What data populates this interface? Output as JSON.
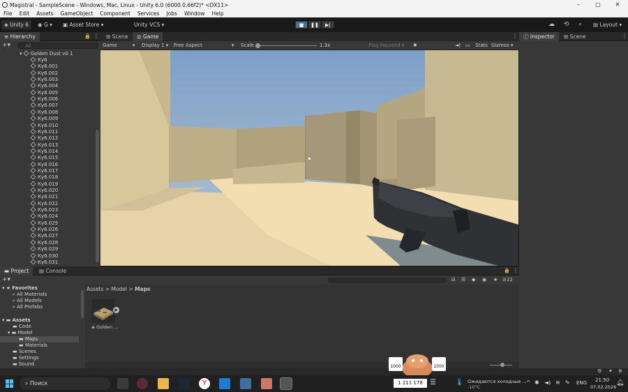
{
  "window": {
    "title": "Magistral - SampleScene - Windows, Mac, Linux - Unity 6.0 (6000.0.66f2)* <DX11>",
    "minimize": "–",
    "maximize": "□",
    "close": "✕"
  },
  "menu": [
    "File",
    "Edit",
    "Assets",
    "GameObject",
    "Component",
    "Services",
    "Jobs",
    "Window",
    "Help"
  ],
  "toolbar": {
    "account": "Unity 6",
    "user": "G",
    "asset_store": "Asset Store",
    "vcs": "Unity VCS",
    "layout": "Layout"
  },
  "hierarchy": {
    "tab": "Hierarchy",
    "search_placeholder": "All",
    "root": "Golden Dust v0.1",
    "items": [
      "Ку6",
      "Ку6.001",
      "Ку6.002",
      "Ку6.003",
      "Ку6.004",
      "Ку6.005",
      "Ку6.006",
      "Ку6.007",
      "Ку6.008",
      "Ку6.009",
      "Ку6.010",
      "Ку6.011",
      "Ку6.012",
      "Ку6.013",
      "Ку6.014",
      "Ку6.015",
      "Ку6.016",
      "Ку6.017",
      "Ку6.018",
      "Ку6.019",
      "Ку6.020",
      "Ку6.021",
      "Ку6.022",
      "Ку6.023",
      "Ку6.024",
      "Ку6.025",
      "Ку6.026",
      "Ку6.027",
      "Ку6.028",
      "Ку6.029",
      "Ку6.030",
      "Ку6.031"
    ]
  },
  "game": {
    "tab_scene": "Scene",
    "tab_game": "Game",
    "mode": "Game",
    "display": "Display 1",
    "aspect": "Free Aspect",
    "scale_label": "Scale",
    "scale_value": "1.3x",
    "play_focused": "Play Focused",
    "stats": "Stats",
    "gizmos": "Gizmos"
  },
  "inspector": {
    "tab": "Inspector",
    "tab2": "Scene"
  },
  "project": {
    "tab": "Project",
    "tab2": "Console",
    "count": "22",
    "breadcrumb": [
      "Assets",
      "Model",
      "Maps"
    ],
    "favorites": "Favorites",
    "fav_items": [
      "All Materials",
      "All Models",
      "All Prefabs"
    ],
    "assets": "Assets",
    "tree": [
      "Code",
      "Model",
      "Maps",
      "Materials",
      "Scenes",
      "Settings",
      "Sound"
    ],
    "asset_name": "Golden ..."
  },
  "taskbar": {
    "search": "Поиск",
    "score": "1 211 178",
    "badge_left": "1000",
    "badge_right": "1000",
    "weather_text": "Ожидаются холодные ...",
    "weather_temp": "-10°C",
    "lang": "ENG",
    "time": "21:50",
    "date": "07.02.2026"
  }
}
